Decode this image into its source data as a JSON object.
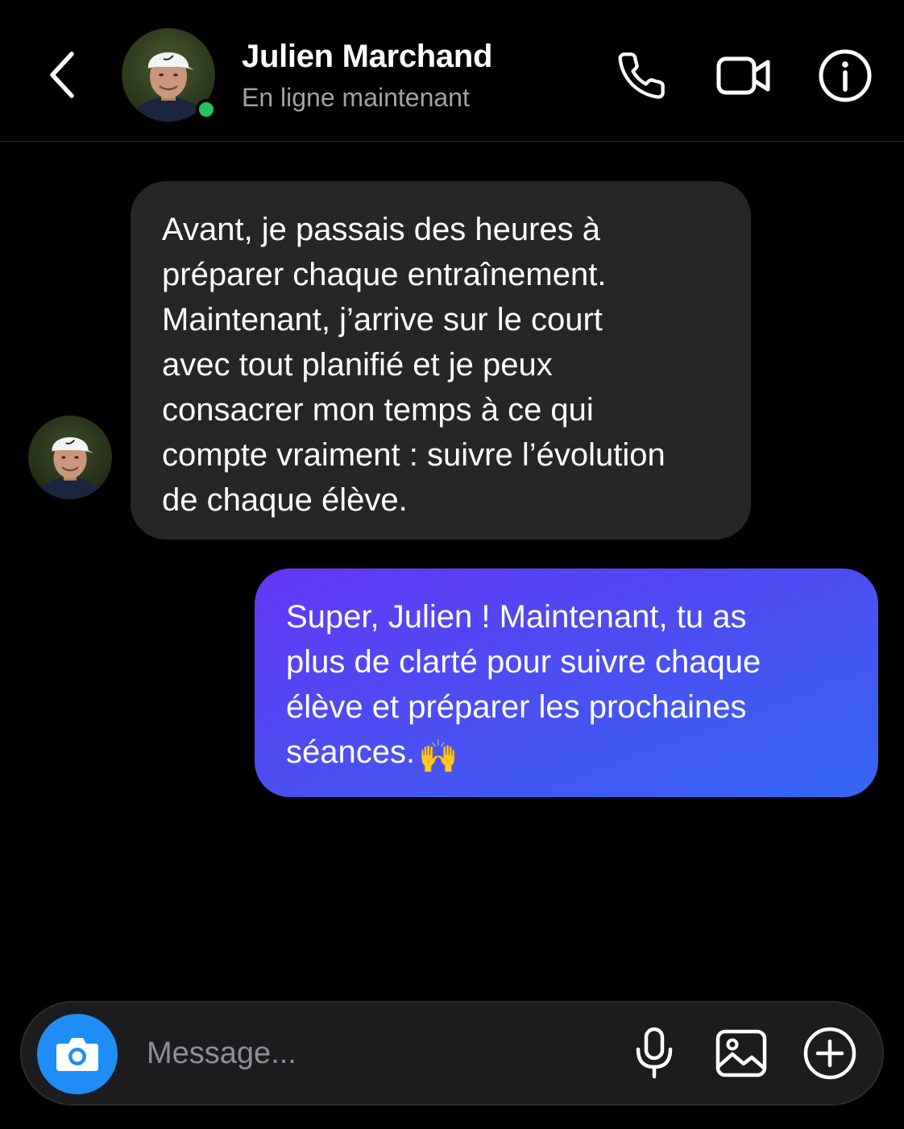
{
  "header": {
    "back_icon": "chevron-left-icon",
    "contact_name": "Julien Marchand",
    "status": "En ligne maintenant",
    "online_color": "#22c55e",
    "icons": [
      "phone-icon",
      "video-camera-icon",
      "info-icon"
    ]
  },
  "messages": [
    {
      "direction": "incoming",
      "bubble_color": "#262628",
      "lines": [
        "Avant, je passais des heures à",
        "préparer chaque entraînement.",
        "Maintenant, j’arrive sur le court",
        "avec tout planifié et je peux",
        "consacrer mon temps à ce qui",
        "compte vraiment : suivre l’évolution",
        "de chaque élève."
      ]
    },
    {
      "direction": "outgoing",
      "bubble_gradient": [
        "#6438f5",
        "#3466f3"
      ],
      "lines": [
        "Super, Julien ! Maintenant, tu as",
        "plus de clarté pour suivre chaque",
        "élève et préparer les prochaines",
        "séances."
      ],
      "emoji": "🙌"
    }
  ],
  "composer": {
    "placeholder": "Message...",
    "camera_color": "#1e8ef6",
    "icons": [
      "camera-icon",
      "microphone-icon",
      "image-icon",
      "plus-circle-icon"
    ]
  }
}
